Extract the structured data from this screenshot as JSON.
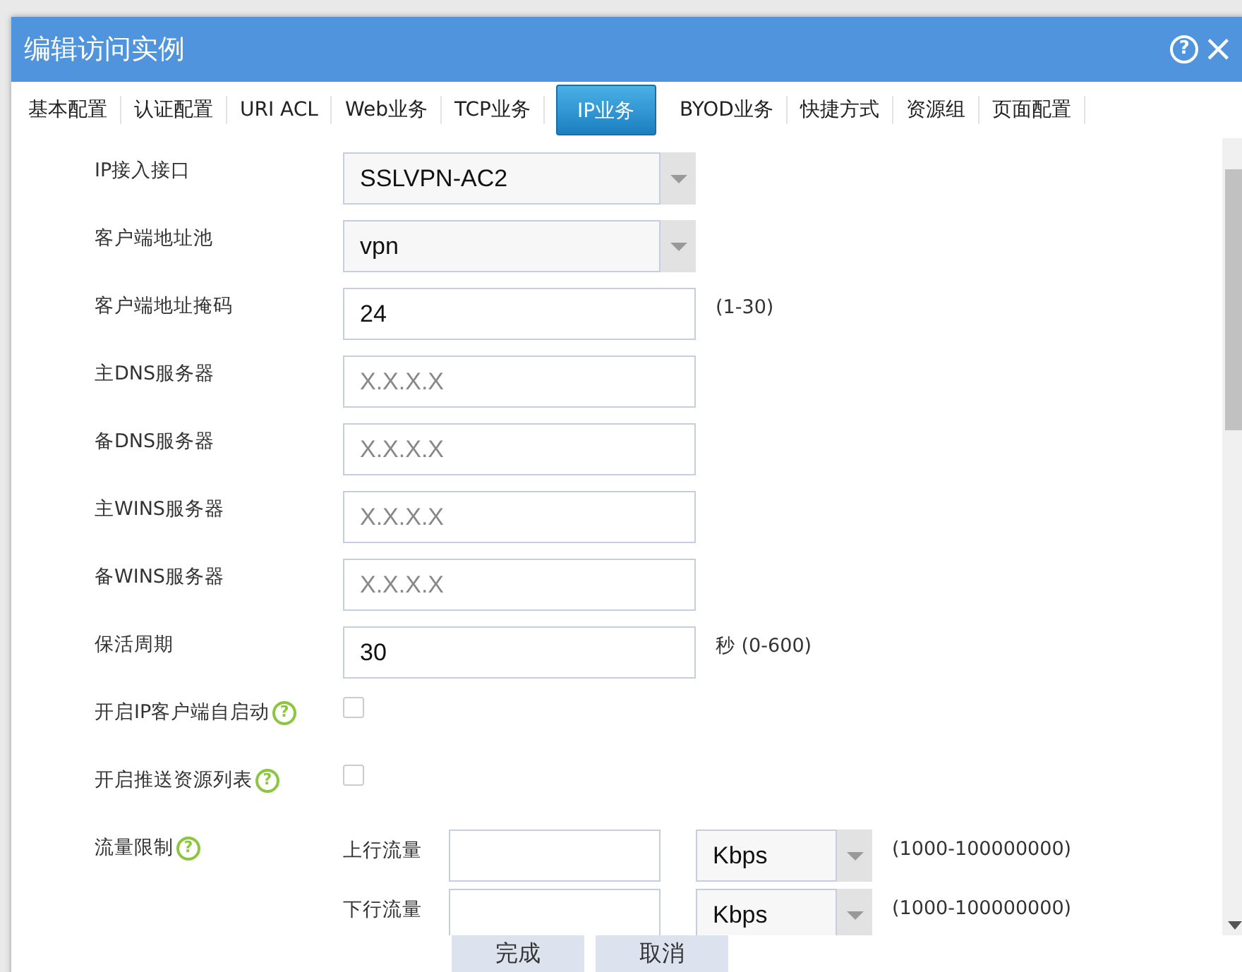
{
  "dialog": {
    "title": "编辑访问实例",
    "help_glyph": "?",
    "close_glyph": "×"
  },
  "tabs": [
    {
      "label": "基本配置",
      "selected": false
    },
    {
      "label": "认证配置",
      "selected": false
    },
    {
      "label": "URI ACL",
      "selected": false
    },
    {
      "label": "Web业务",
      "selected": false
    },
    {
      "label": "TCP业务",
      "selected": false
    },
    {
      "label": "IP业务",
      "selected": true
    },
    {
      "label": "BYOD业务",
      "selected": false
    },
    {
      "label": "快捷方式",
      "selected": false
    },
    {
      "label": "资源组",
      "selected": false
    },
    {
      "label": "页面配置",
      "selected": false
    }
  ],
  "fields": [
    {
      "kind": "select",
      "label": "IP接入接口",
      "value": "SSLVPN-AC2"
    },
    {
      "kind": "select",
      "label": "客户端地址池",
      "value": "vpn"
    },
    {
      "kind": "input",
      "label": "客户端地址掩码",
      "value": "24",
      "hint": "(1-30)"
    },
    {
      "kind": "input",
      "label": "主DNS服务器",
      "placeholder": "X.X.X.X"
    },
    {
      "kind": "input",
      "label": "备DNS服务器",
      "placeholder": "X.X.X.X"
    },
    {
      "kind": "input",
      "label": "主WINS服务器",
      "placeholder": "X.X.X.X"
    },
    {
      "kind": "input",
      "label": "备WINS服务器",
      "placeholder": "X.X.X.X"
    },
    {
      "kind": "input",
      "label": "保活周期",
      "value": "30",
      "hint": "秒 (0-600)"
    },
    {
      "kind": "check",
      "label": "开启IP客户端自启动",
      "help_glyph": "?",
      "checked": false
    },
    {
      "kind": "check",
      "label": "开启推送资源列表",
      "help_glyph": "?",
      "checked": false
    },
    {
      "kind": "traffic",
      "label": "流量限制",
      "help_glyph": "?",
      "lines": [
        {
          "label": "上行流量",
          "unit": "Kbps",
          "hint": "(1000-100000000)"
        },
        {
          "label": "下行流量",
          "unit": "Kbps",
          "hint": "(1000-100000000)"
        }
      ]
    }
  ],
  "buttons": [
    "完成",
    "取消"
  ]
}
